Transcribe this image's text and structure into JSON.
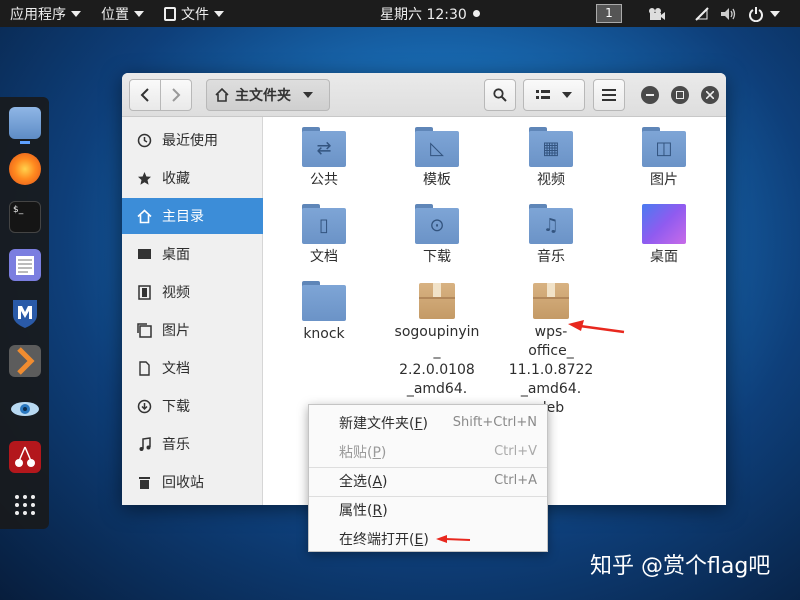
{
  "topbar": {
    "apps_label": "应用程序",
    "places_label": "位置",
    "files_label": "文件",
    "clock": "星期六 12:30",
    "workspace": "1"
  },
  "headerbar": {
    "path_label": "主文件夹"
  },
  "sidebar": {
    "items": [
      {
        "label": "最近使用",
        "icon": "clock-icon"
      },
      {
        "label": "收藏",
        "icon": "star-icon"
      },
      {
        "label": "主目录",
        "icon": "home-icon"
      },
      {
        "label": "桌面",
        "icon": "desktop-icon"
      },
      {
        "label": "视频",
        "icon": "film-icon"
      },
      {
        "label": "图片",
        "icon": "image-icon"
      },
      {
        "label": "文档",
        "icon": "document-icon"
      },
      {
        "label": "下载",
        "icon": "download-icon"
      },
      {
        "label": "音乐",
        "icon": "music-icon"
      },
      {
        "label": "回收站",
        "icon": "trash-icon"
      }
    ]
  },
  "files": [
    {
      "label": "公共",
      "icon": "share-folder-icon"
    },
    {
      "label": "模板",
      "icon": "template-folder-icon"
    },
    {
      "label": "视频",
      "icon": "video-folder-icon"
    },
    {
      "label": "图片",
      "icon": "pictures-folder-icon"
    },
    {
      "label": "文档",
      "icon": "documents-folder-icon"
    },
    {
      "label": "下载",
      "icon": "downloads-folder-icon"
    },
    {
      "label": "音乐",
      "icon": "music-folder-icon"
    },
    {
      "label": "桌面",
      "icon": "desktop-folder-icon"
    },
    {
      "label": "knock",
      "icon": "folder-icon"
    },
    {
      "label_lines": [
        "sogoupinyin",
        "_",
        "2.2.0.0108",
        "_amd64."
      ],
      "icon": "package-icon"
    },
    {
      "label_lines": [
        "wps-",
        "office_",
        "11.1.0.8722",
        "_amd64.",
        "deb"
      ],
      "icon": "package-icon"
    }
  ],
  "context_menu": [
    {
      "label": "新建文件夹(",
      "mnemonic": "F",
      "shortcut": "Shift+Ctrl+N"
    },
    {
      "label": "粘贴(",
      "mnemonic": "P",
      "shortcut": "Ctrl+V"
    },
    {
      "label": "全选(",
      "mnemonic": "A",
      "shortcut": "Ctrl+A"
    },
    {
      "label": "属性(",
      "mnemonic": "R",
      "shortcut": ""
    },
    {
      "label": "在终端打开(",
      "mnemonic": "E",
      "shortcut": ""
    }
  ],
  "watermark": "知乎 @赏个flag吧",
  "colors": {
    "accent": "#3c8dd8",
    "annotation_arrow": "#e8281e"
  }
}
